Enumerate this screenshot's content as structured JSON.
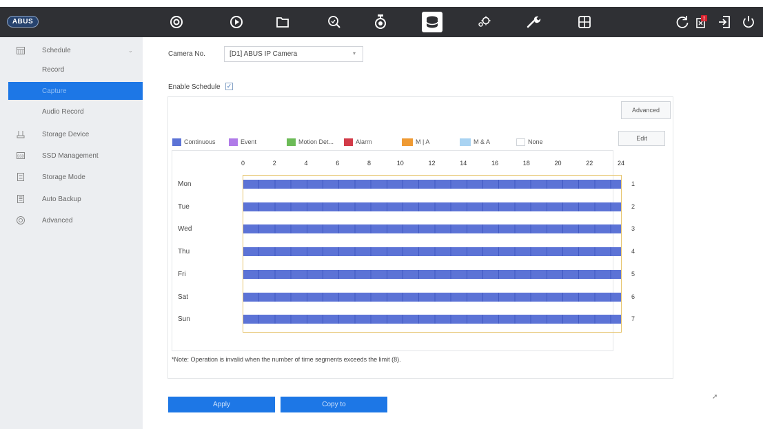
{
  "brand": {
    "logo_text": "ABUS"
  },
  "topbar": {
    "icons": [
      {
        "name": "live-view-icon"
      },
      {
        "name": "playback-icon"
      },
      {
        "name": "file-management-icon"
      },
      {
        "name": "smart-search-icon"
      },
      {
        "name": "camera-icon"
      },
      {
        "name": "storage-icon",
        "active": true
      },
      {
        "name": "configuration-icon"
      },
      {
        "name": "maintenance-icon"
      },
      {
        "name": "layout-icon"
      }
    ],
    "right_icons": [
      "refresh-icon",
      "alarm-icon",
      "logout-icon",
      "power-icon"
    ],
    "alert_badge": "!"
  },
  "sidebar": {
    "items": [
      {
        "label": "Schedule",
        "icon": "calendar-icon",
        "expanded": true
      },
      {
        "label": "Record",
        "sub": true
      },
      {
        "label": "Capture",
        "sub": true,
        "selected": true
      },
      {
        "label": "Audio Record",
        "sub": true
      },
      {
        "label": "Storage Device",
        "icon": "storage-device-icon"
      },
      {
        "label": "SSD Management",
        "icon": "ssd-icon"
      },
      {
        "label": "Storage Mode",
        "icon": "storage-mode-icon"
      },
      {
        "label": "Auto Backup",
        "icon": "backup-icon"
      },
      {
        "label": "Advanced",
        "icon": "advanced-icon"
      }
    ]
  },
  "form": {
    "camera_label": "Camera No.",
    "camera_value": "[D1] ABUS IP Camera",
    "enable_label": "Enable Schedule",
    "enable_checked": true,
    "enable_mark": "✓"
  },
  "panel": {
    "advanced_button": "Advanced",
    "edit_button": "Edit"
  },
  "legend": [
    {
      "label": "Continuous",
      "color": "#5c73d6"
    },
    {
      "label": "Event",
      "color": "#b07be8"
    },
    {
      "label": "Motion Det...",
      "color": "#6cbb57"
    },
    {
      "label": "Alarm",
      "color": "#d23b48"
    },
    {
      "label": "M | A",
      "color": "#ef9a33"
    },
    {
      "label": "M & A",
      "color": "#a9d3f2"
    },
    {
      "label": "None",
      "color": "#ffffff"
    }
  ],
  "hours": [
    "0",
    "2",
    "4",
    "6",
    "8",
    "10",
    "12",
    "14",
    "16",
    "18",
    "20",
    "22",
    "24"
  ],
  "days": [
    {
      "label": "Mon",
      "num": "1",
      "from": 0,
      "to": 24,
      "type": "Continuous"
    },
    {
      "label": "Tue",
      "num": "2",
      "from": 0,
      "to": 24,
      "type": "Continuous"
    },
    {
      "label": "Wed",
      "num": "3",
      "from": 0,
      "to": 24,
      "type": "Continuous"
    },
    {
      "label": "Thu",
      "num": "4",
      "from": 0,
      "to": 24,
      "type": "Continuous"
    },
    {
      "label": "Fri",
      "num": "5",
      "from": 0,
      "to": 24,
      "type": "Continuous"
    },
    {
      "label": "Sat",
      "num": "6",
      "from": 0,
      "to": 24,
      "type": "Continuous"
    },
    {
      "label": "Sun",
      "num": "7",
      "from": 0,
      "to": 24,
      "type": "Continuous"
    }
  ],
  "note": "*Note: Operation is invalid when the number of time segments exceeds the limit (8).",
  "buttons": {
    "apply": "Apply",
    "copy": "Copy to"
  },
  "colors": {
    "accent": "#1d77e6",
    "topbar": "#2f3034",
    "sidebar": "#eceef1"
  }
}
